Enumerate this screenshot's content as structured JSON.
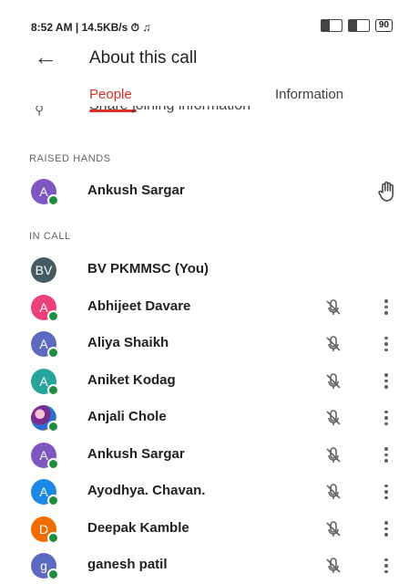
{
  "status_bar": {
    "left_text": "8:52 AM | 14.5KB/s ⏱ ♫",
    "battery": "90"
  },
  "app_bar": {
    "title": "About this call",
    "back_icon": "arrow-left-icon"
  },
  "tabs": [
    {
      "label": "People",
      "active": true
    },
    {
      "label": "Information",
      "active": false
    }
  ],
  "partial_row": {
    "label": "Share joining information",
    "icon": "share-icon"
  },
  "raised_hands": {
    "header": "RAISED HANDS",
    "people": [
      {
        "initial": "A",
        "name": "Ankush Sargar",
        "color": "#7e57c2"
      }
    ]
  },
  "in_call": {
    "header": "IN CALL",
    "people": [
      {
        "initial": "BV",
        "name": "BV PKMMSC (You)",
        "color": "#455a64",
        "self": true
      },
      {
        "initial": "A",
        "name": "Abhijeet Davare",
        "color": "#ec407a"
      },
      {
        "initial": "A",
        "name": "Aliya Shaikh",
        "color": "#5c6bc0"
      },
      {
        "initial": "A",
        "name": "Aniket Kodag",
        "color": "#26a69a"
      },
      {
        "initial": "",
        "name": "Anjali Chole",
        "color": "#7a2c8f",
        "photo": true
      },
      {
        "initial": "A",
        "name": "Ankush Sargar",
        "color": "#7e57c2"
      },
      {
        "initial": "A",
        "name": "Ayodhya. Chavan.",
        "color": "#1e88e5"
      },
      {
        "initial": "D",
        "name": "Deepak Kamble",
        "color": "#ef6c00"
      },
      {
        "initial": "g",
        "name": "ganesh patil",
        "color": "#5c6bc0"
      }
    ]
  },
  "colors": {
    "accent": "#d93025",
    "online": "#1e8e3e"
  }
}
